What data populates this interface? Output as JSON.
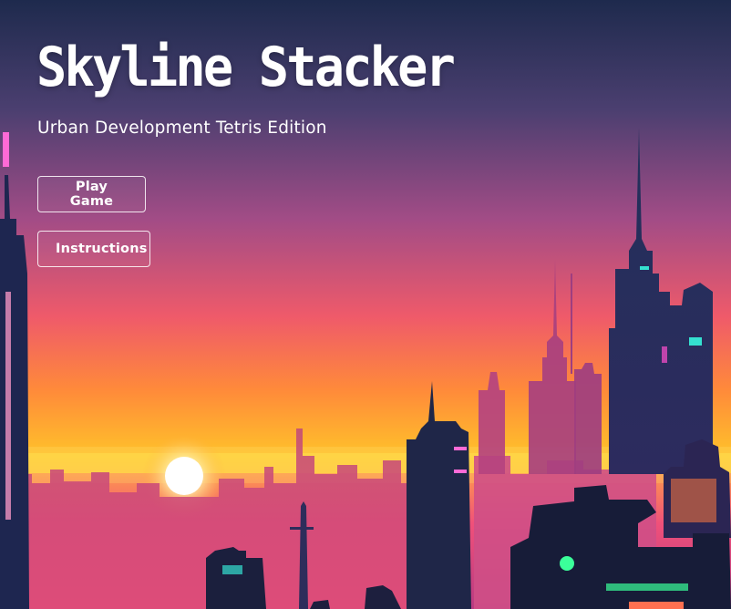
{
  "game": {
    "title": "Skyline Stacker",
    "subtitle": "Urban Development Tetris Edition"
  },
  "menu": {
    "play_label": "Play Game",
    "instructions_label": "Instructions"
  },
  "palette": {
    "sky_top": "#1e2a4d",
    "sky_mid": "#b5498a",
    "sky_glow": "#ff6a3c",
    "horizon": "#ffc22a",
    "ground": "#e0456e",
    "silhouette": "#1a2140",
    "neon_cyan": "#35e0d0",
    "neon_pink": "#ff4fcf",
    "neon_green": "#3bff9a"
  }
}
